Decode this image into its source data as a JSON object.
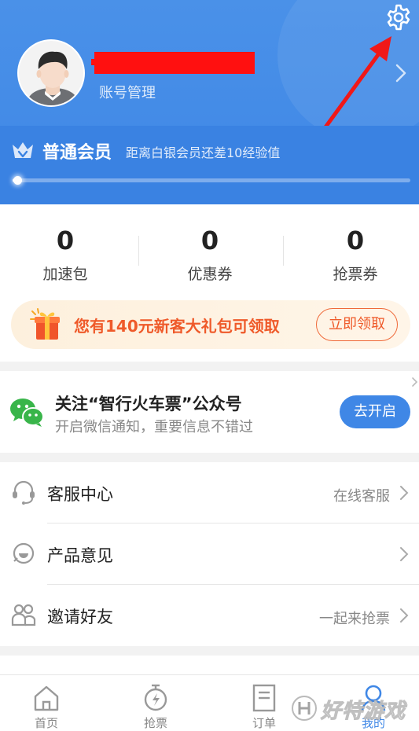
{
  "header": {
    "account_label": "账号管理",
    "member": {
      "level": "普通会员",
      "description": "距离白银会员还差10经验值",
      "progress": 0.01
    }
  },
  "stats": [
    {
      "value": "0",
      "label": "加速包"
    },
    {
      "value": "0",
      "label": "优惠券"
    },
    {
      "value": "0",
      "label": "抢票券"
    }
  ],
  "gift_banner": {
    "text": "您有140元新客大礼包可领取",
    "button": "立即领取"
  },
  "wechat": {
    "title": "关注“智行火车票”公众号",
    "subtitle": "开启微信通知，重要信息不错过",
    "button": "去开启"
  },
  "menu": [
    {
      "title": "客服中心",
      "right": "在线客服",
      "icon": "headset-icon"
    },
    {
      "title": "产品意见",
      "right": "",
      "icon": "feedback-icon"
    },
    {
      "title": "邀请好友",
      "right": "一起来抢票",
      "icon": "friends-icon"
    }
  ],
  "tabs": [
    {
      "label": "首页",
      "icon": "home-icon",
      "active": false
    },
    {
      "label": "抢票",
      "icon": "stopwatch-icon",
      "active": false
    },
    {
      "label": "订单",
      "icon": "order-icon",
      "active": false
    },
    {
      "label": "我的",
      "icon": "profile-icon",
      "active": true
    }
  ],
  "watermark": "好特游戏",
  "colors": {
    "primary": "#3f87e6",
    "gift_accent": "#ef5a2a",
    "redaction": "#ff1010",
    "annotation_arrow": "#f01818"
  }
}
